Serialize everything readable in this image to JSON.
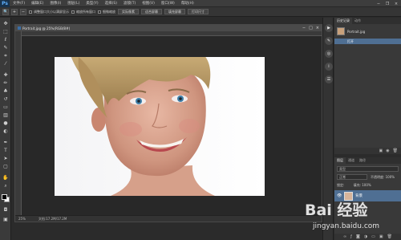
{
  "app": {
    "logo": "Ps"
  },
  "menu": [
    "文件(F)",
    "编辑(E)",
    "图像(I)",
    "图层(L)",
    "类型(Y)",
    "选择(S)",
    "滤镜(T)",
    "视图(V)",
    "窗口(W)",
    "帮助(H)"
  ],
  "window_controls": {
    "minimize": "−",
    "restore": "❐",
    "close": "×"
  },
  "options_bar": {
    "check_resize": "调整窗口大小以满屏显示",
    "check_zoom_all": "缩放所有窗口",
    "check_scrubby": "细微缩放",
    "btn_actual": "实际像素",
    "btn_fit": "适合屏幕",
    "btn_fill": "填充屏幕",
    "btn_print": "打印尺寸"
  },
  "document": {
    "title": "Portrait.jpg @ 25%(RGB/8#)",
    "zoom": "25%",
    "file_info": "文档:17.2M/17.2M"
  },
  "history": {
    "tabs": [
      "历史记录",
      "动作"
    ],
    "snapshot": "Portrait.jpg",
    "step": "打开"
  },
  "layers": {
    "tabs": [
      "图层",
      "通道",
      "路径"
    ],
    "filter_label": "类型",
    "blend_mode": "正常",
    "opacity_label": "不透明度: 100%",
    "lock_label": "锁定:",
    "fill_label": "填充: 100%",
    "layer_name": "背景"
  },
  "watermark": {
    "brand": "Bai 经验",
    "url": "jingyan.baidu.com"
  }
}
